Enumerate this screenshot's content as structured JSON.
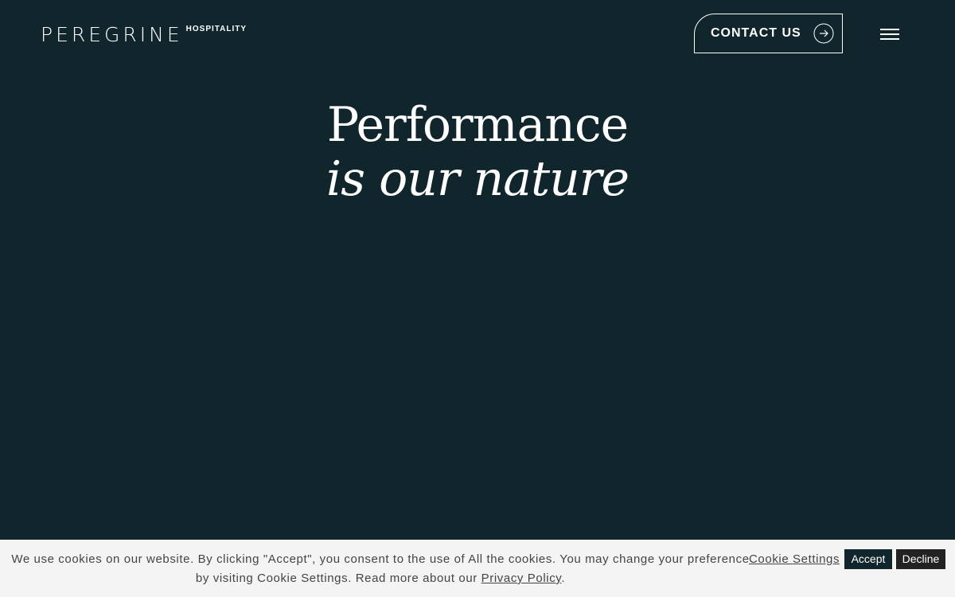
{
  "colors": {
    "background": "#10252c",
    "text": "#ffffff",
    "cookie_bar_bg": "#f4f4f4",
    "cookie_text": "#444444",
    "accept_bg": "#10252c",
    "decline_bg": "#222222"
  },
  "header": {
    "logo_main": "PEREGRINE",
    "logo_sub": "HOSPITALITY",
    "contact_label": "CONTACT US",
    "contact_icon": "arrow-right-circle-icon",
    "menu_icon": "hamburger-menu-icon"
  },
  "hero": {
    "line1": "Performance",
    "line2": "is our nature"
  },
  "cookie_bar": {
    "text_part1": "We use cookies on our website. By clicking \"Accept\", you consent to the use of All the cookies. You may change your preference by visiting Cookie Settings. Read more about our ",
    "privacy_link": "Privacy Policy",
    "text_end": ".",
    "settings_link": "Cookie Settings",
    "accept_label": "Accept",
    "decline_label": "Decline"
  }
}
